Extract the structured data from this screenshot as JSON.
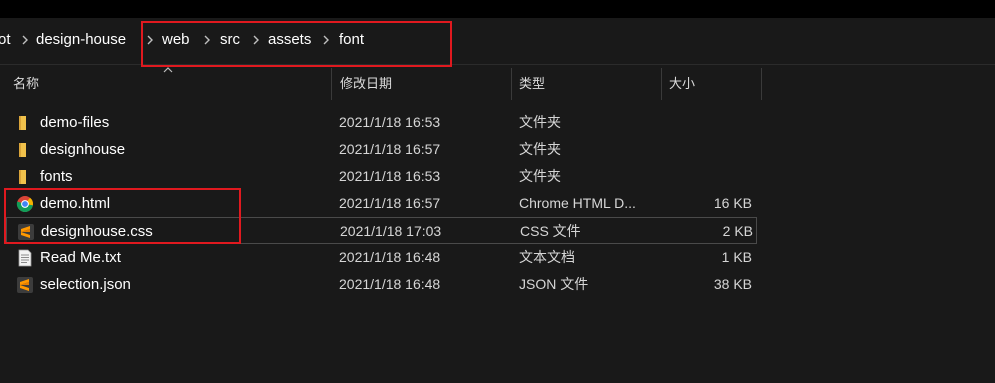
{
  "address": {
    "crumbs": [
      "ot",
      "design-house",
      "web",
      "src",
      "assets",
      "font"
    ]
  },
  "columns": {
    "name": "名称",
    "modified": "修改日期",
    "type": "类型",
    "size": "大小"
  },
  "files": [
    {
      "name": "demo-files",
      "modified": "2021/1/18 16:53",
      "type": "文件夹",
      "size": "",
      "icon": "folder-icon"
    },
    {
      "name": "designhouse",
      "modified": "2021/1/18 16:57",
      "type": "文件夹",
      "size": "",
      "icon": "folder-icon"
    },
    {
      "name": "fonts",
      "modified": "2021/1/18 16:53",
      "type": "文件夹",
      "size": "",
      "icon": "folder-icon"
    },
    {
      "name": "demo.html",
      "modified": "2021/1/18 16:57",
      "type": "Chrome HTML D...",
      "size": "16 KB",
      "icon": "chrome-icon"
    },
    {
      "name": "designhouse.css",
      "modified": "2021/1/18 17:03",
      "type": "CSS 文件",
      "size": "2 KB",
      "icon": "sublime-icon"
    },
    {
      "name": "Read Me.txt",
      "modified": "2021/1/18 16:48",
      "type": "文本文档",
      "size": "1 KB",
      "icon": "text-file-icon"
    },
    {
      "name": "selection.json",
      "modified": "2021/1/18 16:48",
      "type": "JSON 文件",
      "size": "38 KB",
      "icon": "sublime-icon"
    }
  ],
  "colors": {
    "background": "#191919",
    "highlight_box": "#e0191f",
    "folder": "#f0c14b"
  }
}
